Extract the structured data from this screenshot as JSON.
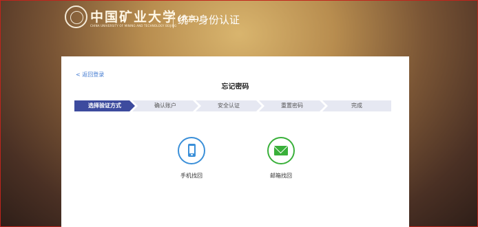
{
  "header": {
    "logo_cn": "中国矿业大学",
    "logo_cn_paren": "(北京)",
    "logo_en": "CHINA UNIVERSITY OF MINING AND TECHNOLOGY BEIJING",
    "system_title": "统一身份认证"
  },
  "card": {
    "back_link": "< 返回登录",
    "title": "忘记密码",
    "steps": [
      {
        "label": "选择验证方式",
        "active": true
      },
      {
        "label": "确认账户",
        "active": false
      },
      {
        "label": "安全认证",
        "active": false
      },
      {
        "label": "重置密码",
        "active": false
      },
      {
        "label": "完成",
        "active": false
      }
    ],
    "options": [
      {
        "label": "手机找回",
        "icon": "phone-icon",
        "color": "#3a8fd8"
      },
      {
        "label": "邮箱找回",
        "icon": "mail-icon",
        "color": "#39b03a"
      }
    ]
  }
}
